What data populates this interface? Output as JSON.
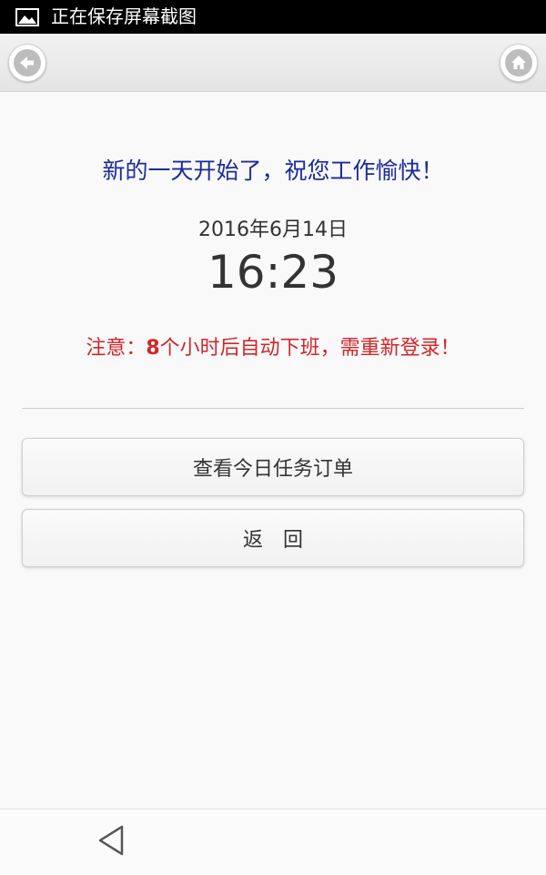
{
  "status_bar": {
    "icon": "image-icon",
    "text": "正在保存屏幕截图"
  },
  "header": {
    "back_icon": "arrow-left-icon",
    "home_icon": "home-icon"
  },
  "main": {
    "greeting": "新的一天开始了，祝您工作愉快！",
    "date": "2016年6月14日",
    "time": "16:23",
    "notice_prefix": "注意：",
    "notice_hours": "8",
    "notice_suffix": "个小时后自动下班，需重新登录！"
  },
  "buttons": {
    "orders_label": "查看今日任务订单",
    "back_label": "返　回"
  },
  "nav_bar": {
    "back_icon": "triangle-back-icon"
  },
  "colors": {
    "greeting": "#1c2b99",
    "notice": "#d0262a",
    "status_bar": "#000000"
  }
}
